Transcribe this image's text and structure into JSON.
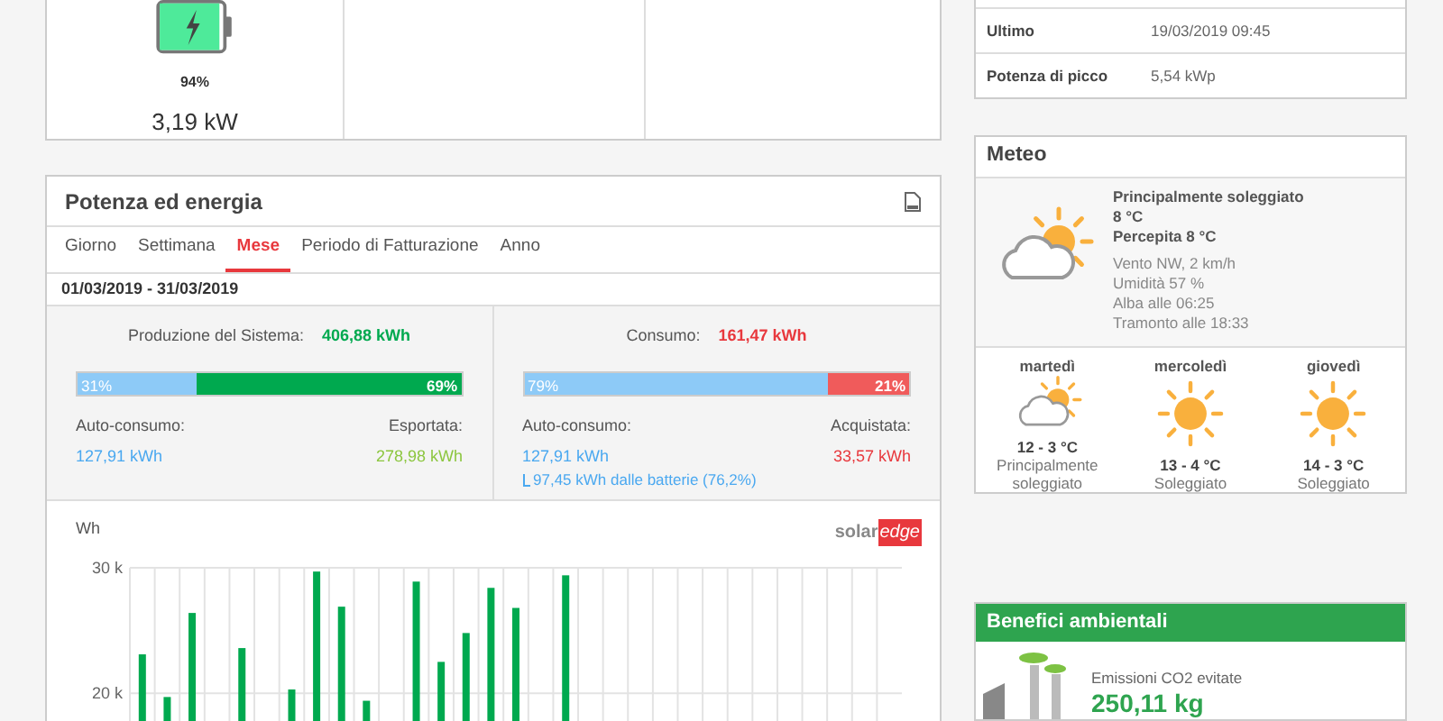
{
  "battery_card": {
    "level": 0.94,
    "percent": "94%",
    "power": "3,19 kW"
  },
  "energy_panel": {
    "title": "Potenza ed energia",
    "tabs": [
      {
        "label": "Giorno",
        "selected": false
      },
      {
        "label": "Settimana",
        "selected": false
      },
      {
        "label": "Mese",
        "selected": true
      },
      {
        "label": "Periodo di Fatturazione",
        "selected": false
      },
      {
        "label": "Anno",
        "selected": false
      }
    ],
    "date_range": "01/03/2019 - 31/03/2019",
    "production": {
      "label": "Produzione del Sistema:",
      "value": "406,88 kWh",
      "level": 0.31,
      "left_pct": "31%",
      "right_pct": "69%",
      "left_label": "Auto-consumo:",
      "left_value": "127,91 kWh",
      "right_label": "Esportata:",
      "right_value": "278,98 kWh"
    },
    "consumption": {
      "label": "Consumo:",
      "value": "161,47 kWh",
      "level": 0.79,
      "left_pct": "79%",
      "right_pct": "21%",
      "left_label": "Auto-consumo:",
      "left_value": "127,91 kWh",
      "battery_note": "97,45 kWh dalle batterie (76,2%)",
      "right_label": "Acquistata:",
      "right_value": "33,57 kWh"
    },
    "chart": {
      "logo_left": "solar",
      "logo_right": "edge",
      "chart_data": {
        "type": "bar",
        "ylabel": "Wh",
        "series": [
          {
            "color": "#00a94f",
            "values": [
              23100,
              19700,
              26400,
              null,
              23600,
              null,
              20300,
              29700,
              26900,
              19400,
              null,
              28900,
              22500,
              24800,
              28400,
              26800,
              null,
              29400,
              null,
              null,
              null,
              null,
              null,
              null,
              null,
              null,
              null,
              null,
              null,
              null,
              null
            ]
          }
        ],
        "ylim": [
          17500,
          30000
        ],
        "yticks": [
          {
            "value": 20000,
            "label": "20 k"
          },
          {
            "value": 30000,
            "label": "30 k"
          }
        ]
      }
    }
  },
  "site_info": {
    "rows": [
      {
        "label": "Ultimo",
        "value": "19/03/2019 09:45"
      },
      {
        "label": "Potenza di picco",
        "value": "5,54 kWp"
      }
    ]
  },
  "weather": {
    "title": "Meteo",
    "current": {
      "kind": "partly-sunny",
      "condition": "Principalmente soleggiato",
      "temperature": "8 °C",
      "feels_like": "Percepita 8 °C",
      "details": [
        "Vento NW, 2 km/h",
        "Umidità 57 %",
        "Alba alle 06:25",
        "Tramonto alle 18:33"
      ]
    },
    "forecast": [
      {
        "day": "martedì",
        "kind": "partly-sunny",
        "range": "12 - 3 °C",
        "condition": "Principalmente soleggiato"
      },
      {
        "day": "mercoledì",
        "kind": "sunny",
        "range": "13 - 4 °C",
        "condition": "Soleggiato"
      },
      {
        "day": "giovedì",
        "kind": "sunny",
        "range": "14 - 3 °C",
        "condition": "Soleggiato"
      }
    ]
  },
  "benefits": {
    "title": "Benefici ambientali",
    "items": [
      {
        "label": "Emissioni CO2 evitate",
        "value": "250,11 kg"
      }
    ]
  }
}
